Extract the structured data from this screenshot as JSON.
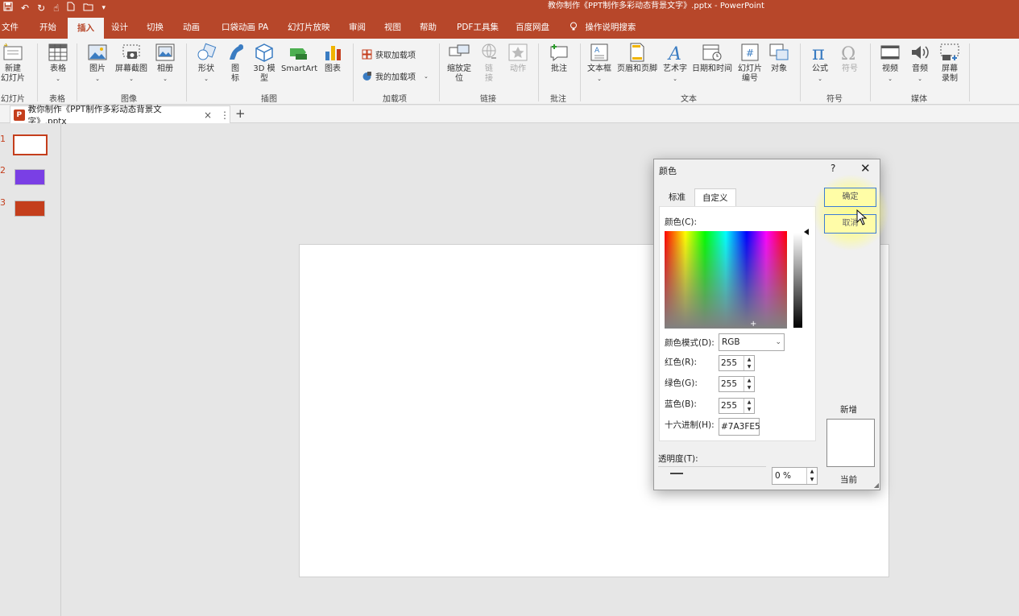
{
  "app": {
    "title": "教你制作《PPT制作多彩动态背景文字》.pptx  -  PowerPoint",
    "brand_color": "#b7472a"
  },
  "quick_access": {
    "icons": [
      "save-icon",
      "undo-icon",
      "redo-icon",
      "touch-mode-icon",
      "new-file-icon",
      "open-file-icon",
      "customize-icon"
    ]
  },
  "ribbon_tabs": [
    "文件",
    "开始",
    "插入",
    "设计",
    "切换",
    "动画",
    "口袋动画 PA",
    "幻灯片放映",
    "审阅",
    "视图",
    "帮助",
    "PDF工具集",
    "百度网盘",
    "操作说明搜索"
  ],
  "active_tab": "插入",
  "ribbon": {
    "new_slide": "新建\n幻灯片",
    "table": "表格",
    "picture": "图片",
    "screenshot": "屏幕截图",
    "album": "相册",
    "shapes": "形状",
    "icons": "图\n标",
    "model3d": "3D 模\n型",
    "smartart": "SmartArt",
    "chart": "图表",
    "get_addins": "获取加载项",
    "my_addins": "我的加载项",
    "zoom": "缩放定\n位",
    "link": "链\n接",
    "action": "动作",
    "comment": "批注",
    "textbox": "文本框",
    "header_footer": "页眉和页脚",
    "wordart": "艺术字",
    "datetime": "日期和时间",
    "slide_number": "幻灯片\n编号",
    "object": "对象",
    "equation": "公式",
    "symbol": "符号",
    "video": "视频",
    "audio": "音频",
    "screen_record": "屏幕\n录制",
    "groups": {
      "slides": "幻灯片",
      "tables": "表格",
      "images": "图像",
      "illustrations": "插图",
      "addins": "加载项",
      "links": "链接",
      "comments": "批注",
      "text": "文本",
      "symbols": "符号",
      "media": "媒体"
    }
  },
  "doc_tab": {
    "label": "教你制作《PPT制作多彩动态背景文字》.pptx",
    "close": "×",
    "more": "⋮",
    "new": "+"
  },
  "thumbnails": [
    {
      "num": "1",
      "color": "#ffffff"
    },
    {
      "num": "2",
      "color": "#7a3fe5"
    },
    {
      "num": "3",
      "color": "#c43e1c"
    }
  ],
  "dialog": {
    "title": "颜色",
    "help": "?",
    "close": "✕",
    "tabs": [
      "标准",
      "自定义"
    ],
    "active_tab": "自定义",
    "colors_label": "颜色(C):",
    "mode_label": "颜色模式(D):",
    "mode_value": "RGB",
    "red_label": "红色(R):",
    "red_value": "255",
    "green_label": "绿色(G):",
    "green_value": "255",
    "blue_label": "蓝色(B):",
    "blue_value": "255",
    "hex_label": "十六进制(H):",
    "hex_value": "#7A3FE5",
    "transparency_label": "透明度(T):",
    "transparency_value": "0 %",
    "ok": "确定",
    "cancel": "取消",
    "new_label": "新增",
    "current_label": "当前",
    "current_color": "#ffffff"
  }
}
